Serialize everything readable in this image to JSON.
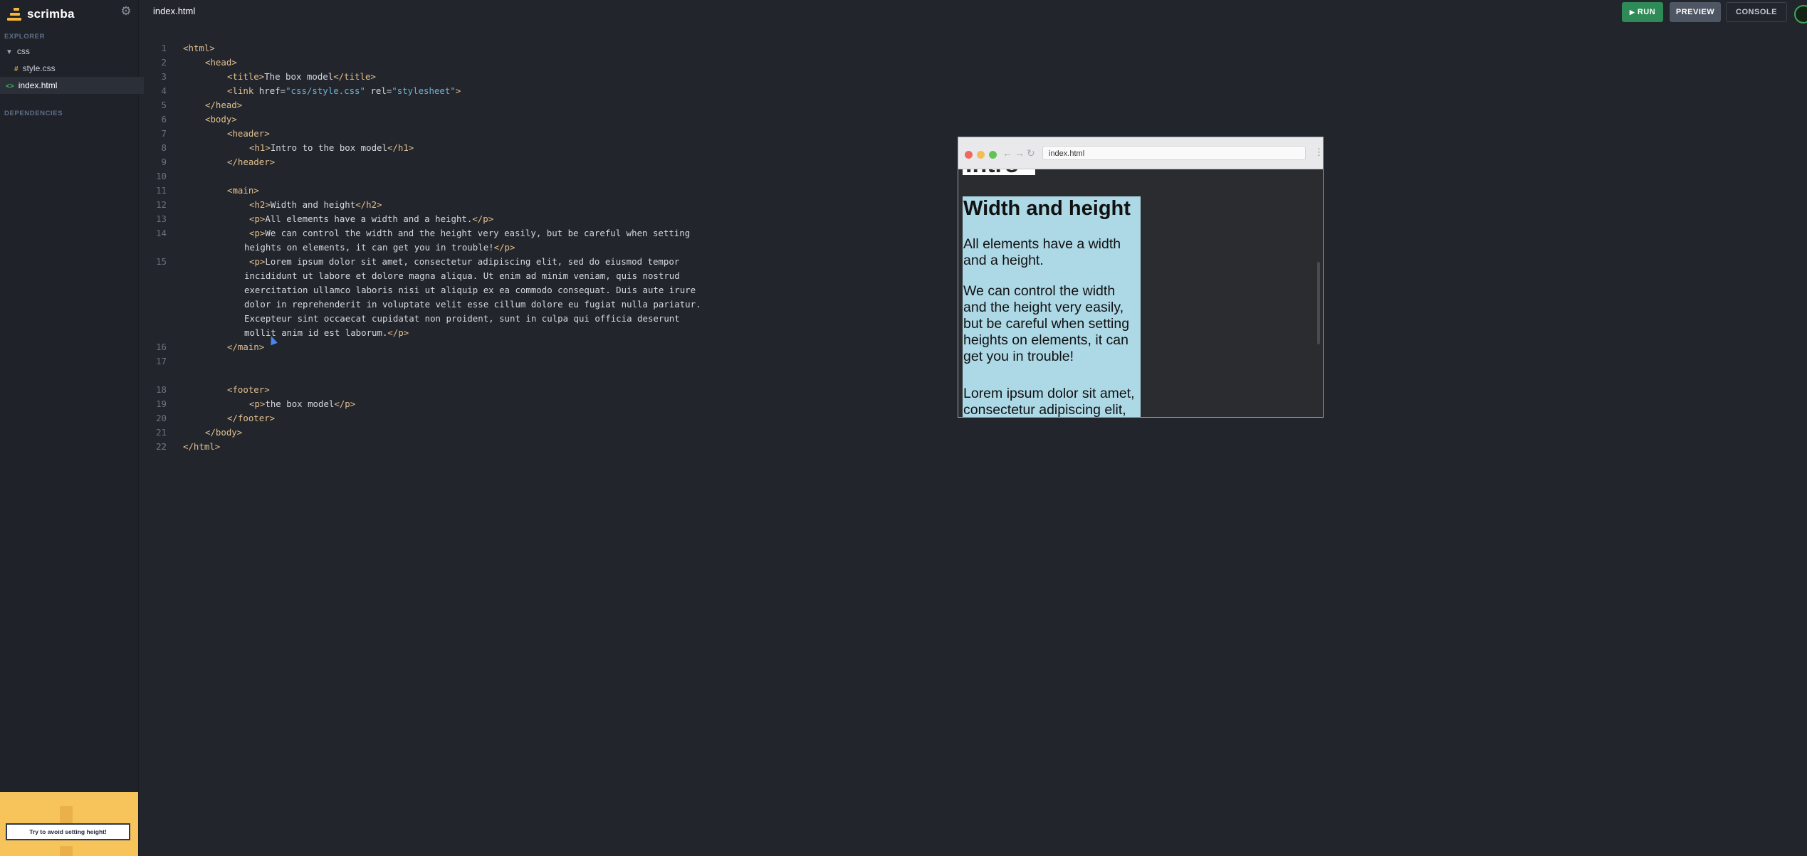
{
  "app": {
    "name": "scrimba"
  },
  "sidebar": {
    "explorer_heading": "EXPLORER",
    "dependencies_heading": "DEPENDENCIES",
    "items": [
      {
        "label": "css",
        "icon": "folder-open-triangle-icon"
      },
      {
        "label": "style.css",
        "icon": "hash-icon"
      },
      {
        "label": "index.html",
        "icon": "code-brackets-icon",
        "active": true
      }
    ],
    "hint": "Try to avoid setting height!"
  },
  "editor": {
    "filename": "index.html",
    "line_numbers": [
      "1",
      "2",
      "3",
      "4",
      "5",
      "6",
      "7",
      "8",
      "9",
      "10",
      "11",
      "12",
      "13",
      "14",
      "15",
      "16",
      "17",
      "18",
      "19",
      "20",
      "21",
      "22"
    ]
  },
  "toolbar": {
    "run": "RUN",
    "preview": "PREVIEW",
    "console": "CONSOLE"
  },
  "preview": {
    "address": "index.html",
    "h1_partial": "Intro",
    "h2": "Width and height",
    "paragraphs": [
      "All elements have a width and a height.",
      "We can control the width and the height very easily, but be careful when setting heights on elements, it can get you in trouble!",
      "Lorem ipsum dolor sit amet, consectetur adipiscing elit, sed do eiusmod tempor"
    ]
  },
  "colors": {
    "accent_run": "#2e8b57",
    "preview_main_bg": "#add8e6",
    "hint_bg": "#f6c45a",
    "brand": "#f5b73b"
  }
}
